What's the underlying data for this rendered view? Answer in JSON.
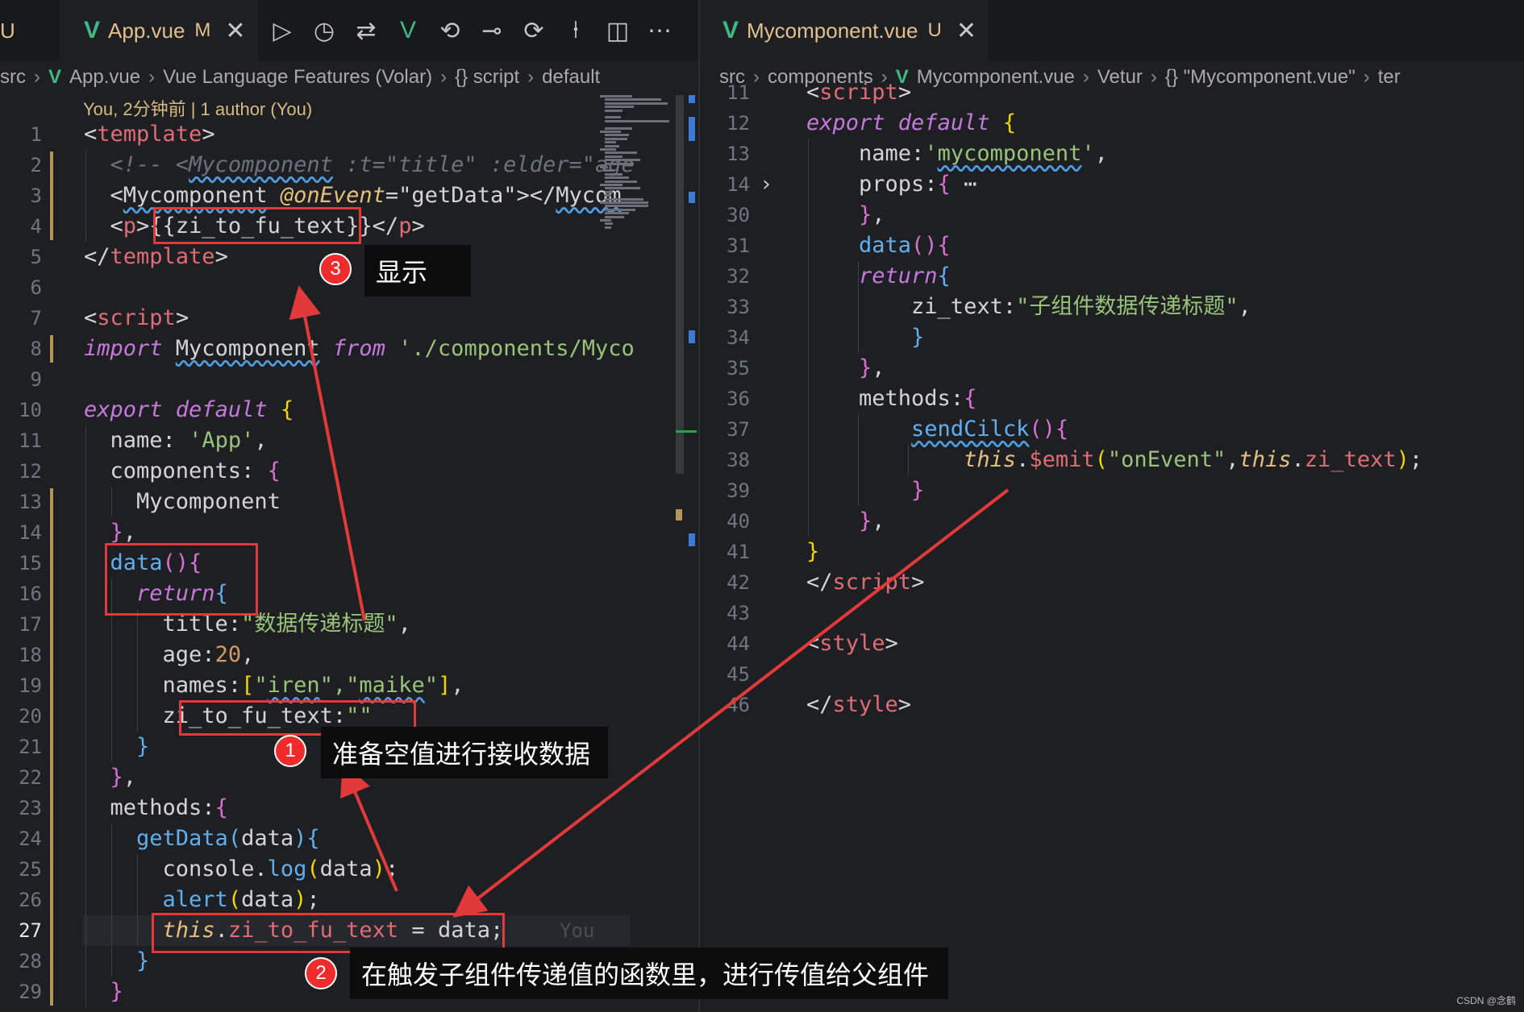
{
  "left": {
    "tab_edge_label": "U",
    "tab": {
      "icon": "vue-icon",
      "label": "App.vue",
      "flag": "M",
      "close": "✕"
    },
    "toolbar": [
      {
        "name": "run-icon",
        "glyph": "▷"
      },
      {
        "name": "timeline-icon",
        "glyph": "◷"
      },
      {
        "name": "compare-changes-icon",
        "glyph": "⇄"
      },
      {
        "name": "vue-devtools-icon",
        "glyph": "V"
      },
      {
        "name": "go-back-icon",
        "glyph": "⟲"
      },
      {
        "name": "commit-icon",
        "glyph": "⊸"
      },
      {
        "name": "go-forward-icon",
        "glyph": "⟳"
      },
      {
        "name": "git-graph-icon",
        "glyph": "⍿"
      },
      {
        "name": "split-editor-icon",
        "glyph": "◫"
      },
      {
        "name": "more-actions-icon",
        "glyph": "⋯"
      }
    ],
    "breadcrumbs": [
      "src",
      "App.vue",
      "Vue Language Features (Volar)",
      "{} script",
      "default"
    ],
    "blame": "You, 2分钟前 | 1 author (You)",
    "ghost_blame": "You",
    "lines": [
      {
        "n": "1",
        "tokens": [
          [
            "<",
            "p"
          ],
          [
            "template",
            "t"
          ],
          [
            ">",
            "p"
          ]
        ]
      },
      {
        "n": "2",
        "tokens": [
          [
            "  <!-- <",
            "c"
          ],
          [
            "Mycomponent",
            "c u"
          ],
          [
            " :t=\"title\" :elder=\"age",
            "c"
          ]
        ]
      },
      {
        "n": "3",
        "tokens": [
          [
            "  <",
            "p"
          ],
          [
            "Mycomponent",
            "p u"
          ],
          [
            " ",
            "p"
          ],
          [
            "@onEvent",
            "v"
          ],
          [
            "=",
            "p"
          ],
          [
            "\"getData\"",
            "p"
          ],
          [
            "></",
            "p"
          ],
          [
            "Mycom",
            "p u"
          ]
        ]
      },
      {
        "n": "4",
        "tokens": [
          [
            "  <",
            "p"
          ],
          [
            "p",
            "t"
          ],
          [
            ">{{",
            "p"
          ],
          [
            "zi_to_fu_text",
            "p"
          ],
          [
            "}}</",
            "p"
          ],
          [
            "p",
            "t"
          ],
          [
            ">",
            "p"
          ]
        ]
      },
      {
        "n": "5",
        "tokens": [
          [
            "</",
            "p"
          ],
          [
            "template",
            "t"
          ],
          [
            ">",
            "p"
          ]
        ]
      },
      {
        "n": "6",
        "tokens": []
      },
      {
        "n": "7",
        "tokens": [
          [
            "<",
            "p"
          ],
          [
            "script",
            "t"
          ],
          [
            ">",
            "p"
          ]
        ]
      },
      {
        "n": "8",
        "tokens": [
          [
            "import ",
            "k"
          ],
          [
            "Mycomponent",
            "p u"
          ],
          [
            " ",
            "p"
          ],
          [
            "from",
            "k"
          ],
          [
            " './components/Myco",
            "s"
          ]
        ]
      },
      {
        "n": "9",
        "tokens": []
      },
      {
        "n": "10",
        "tokens": [
          [
            "export ",
            "k"
          ],
          [
            "default",
            "k"
          ],
          [
            " ",
            "p"
          ],
          [
            "{",
            "b"
          ]
        ]
      },
      {
        "n": "11",
        "tokens": [
          [
            "  name",
            "p"
          ],
          [
            ": ",
            "p"
          ],
          [
            "'App'",
            "s"
          ],
          [
            ",",
            "p"
          ]
        ]
      },
      {
        "n": "12",
        "tokens": [
          [
            "  components",
            "p"
          ],
          [
            ": ",
            "p"
          ],
          [
            "{",
            "y"
          ]
        ]
      },
      {
        "n": "13",
        "tokens": [
          [
            "    Mycomponent",
            "p"
          ]
        ]
      },
      {
        "n": "14",
        "tokens": [
          [
            "  ",
            "p"
          ],
          [
            "}",
            "y"
          ],
          [
            ",",
            "p"
          ]
        ]
      },
      {
        "n": "15",
        "tokens": [
          [
            "  data",
            "f"
          ],
          [
            "(){",
            "y"
          ]
        ]
      },
      {
        "n": "16",
        "tokens": [
          [
            "    ",
            "p"
          ],
          [
            "return",
            "k"
          ],
          [
            "{",
            "f"
          ]
        ]
      },
      {
        "n": "17",
        "tokens": [
          [
            "      title",
            "p"
          ],
          [
            ":",
            "p"
          ],
          [
            "\"数据传递标题\"",
            "s"
          ],
          [
            ",",
            "p"
          ]
        ]
      },
      {
        "n": "18",
        "tokens": [
          [
            "      age",
            "p"
          ],
          [
            ":",
            "p"
          ],
          [
            "20",
            "n"
          ],
          [
            ",",
            "p"
          ]
        ]
      },
      {
        "n": "19",
        "tokens": [
          [
            "      names",
            "p"
          ],
          [
            ":",
            "p"
          ],
          [
            "[",
            "b"
          ],
          [
            "\"",
            "s"
          ],
          [
            "iren",
            "s u"
          ],
          [
            "\",\"",
            "s"
          ],
          [
            "maike",
            "s u"
          ],
          [
            "\"",
            "s"
          ],
          [
            "]",
            "b"
          ],
          [
            ",",
            "p"
          ]
        ]
      },
      {
        "n": "20",
        "tokens": [
          [
            "      zi_to_fu_text",
            "p"
          ],
          [
            ":",
            "p"
          ],
          [
            "\"\"",
            "s"
          ]
        ]
      },
      {
        "n": "21",
        "tokens": [
          [
            "    ",
            "p"
          ],
          [
            "}",
            "f"
          ]
        ]
      },
      {
        "n": "22",
        "tokens": [
          [
            "  ",
            "p"
          ],
          [
            "}",
            "y"
          ],
          [
            ",",
            "p"
          ]
        ]
      },
      {
        "n": "23",
        "tokens": [
          [
            "  methods",
            "p"
          ],
          [
            ":",
            "p"
          ],
          [
            "{",
            "y"
          ]
        ]
      },
      {
        "n": "24",
        "tokens": [
          [
            "    getData",
            "f"
          ],
          [
            "(",
            "f"
          ],
          [
            "data",
            "p"
          ],
          [
            ")",
            "f"
          ],
          [
            "{",
            "f"
          ]
        ]
      },
      {
        "n": "25",
        "tokens": [
          [
            "      console",
            "p"
          ],
          [
            ".",
            "p"
          ],
          [
            "log",
            "f"
          ],
          [
            "(",
            "b"
          ],
          [
            "data",
            "p"
          ],
          [
            ")",
            "b"
          ],
          [
            ";",
            "p"
          ]
        ]
      },
      {
        "n": "26",
        "tokens": [
          [
            "      alert",
            "f"
          ],
          [
            "(",
            "b"
          ],
          [
            "data",
            "p"
          ],
          [
            ")",
            "b"
          ],
          [
            ";",
            "p"
          ]
        ]
      },
      {
        "n": "27",
        "tokens": [
          [
            "      ",
            "p"
          ],
          [
            "this",
            "v"
          ],
          [
            ".",
            "p"
          ],
          [
            "zi_to_fu_text",
            "t"
          ],
          [
            " = ",
            "p"
          ],
          [
            "data",
            "p"
          ],
          [
            ";",
            "p"
          ]
        ]
      },
      {
        "n": "28",
        "tokens": [
          [
            "    ",
            "p"
          ],
          [
            "}",
            "f"
          ]
        ]
      },
      {
        "n": "29",
        "tokens": [
          [
            "  ",
            "p"
          ],
          [
            "}",
            "y"
          ]
        ]
      }
    ]
  },
  "right": {
    "tab": {
      "icon": "vue-icon",
      "label": "Mycomponent.vue",
      "flag": "U",
      "close": "✕"
    },
    "breadcrumbs": [
      "src",
      "components",
      "Mycomponent.vue",
      "Vetur",
      "{} \"Mycomponent.vue\"",
      "ter"
    ],
    "lines": [
      {
        "n": "11",
        "tokens": [
          [
            "<",
            "p"
          ],
          [
            "script",
            "t"
          ],
          [
            ">",
            "p"
          ]
        ]
      },
      {
        "n": "12",
        "tokens": [
          [
            "export ",
            "k"
          ],
          [
            "default",
            "k"
          ],
          [
            " ",
            "p"
          ],
          [
            "{",
            "b"
          ]
        ]
      },
      {
        "n": "13",
        "tokens": [
          [
            "    name",
            "p"
          ],
          [
            ":",
            "p"
          ],
          [
            "'",
            "s"
          ],
          [
            "mycomponent",
            "s u"
          ],
          [
            "'",
            "s"
          ],
          [
            ",",
            "p"
          ]
        ]
      },
      {
        "n": "14",
        "fold": "›",
        "tokens": [
          [
            "    props",
            "p"
          ],
          [
            ":",
            "p"
          ],
          [
            "{",
            "y"
          ],
          [
            " ⋯",
            "p"
          ]
        ]
      },
      {
        "n": "30",
        "tokens": [
          [
            "    ",
            "p"
          ],
          [
            "}",
            "y"
          ],
          [
            ",",
            "p"
          ]
        ]
      },
      {
        "n": "31",
        "tokens": [
          [
            "    data",
            "f"
          ],
          [
            "(){",
            "y"
          ]
        ]
      },
      {
        "n": "32",
        "tokens": [
          [
            "    ",
            "p"
          ],
          [
            "return",
            "k"
          ],
          [
            "{",
            "f"
          ]
        ]
      },
      {
        "n": "33",
        "tokens": [
          [
            "        zi_text",
            "p"
          ],
          [
            ":",
            "p"
          ],
          [
            "\"子组件数据传递标题\"",
            "s"
          ],
          [
            ",",
            "p"
          ]
        ]
      },
      {
        "n": "34",
        "tokens": [
          [
            "        ",
            "p"
          ],
          [
            "}",
            "f"
          ]
        ]
      },
      {
        "n": "35",
        "tokens": [
          [
            "    ",
            "p"
          ],
          [
            "}",
            "y"
          ],
          [
            ",",
            "p"
          ]
        ]
      },
      {
        "n": "36",
        "tokens": [
          [
            "    methods",
            "p"
          ],
          [
            ":",
            "p"
          ],
          [
            "{",
            "y"
          ]
        ]
      },
      {
        "n": "37",
        "tokens": [
          [
            "        ",
            "p"
          ],
          [
            "sendCilck",
            "f u"
          ],
          [
            "(){",
            "y"
          ]
        ]
      },
      {
        "n": "38",
        "tokens": [
          [
            "            ",
            "p"
          ],
          [
            "this",
            "v"
          ],
          [
            ".",
            "p"
          ],
          [
            "$emit",
            "t"
          ],
          [
            "(",
            "b"
          ],
          [
            "\"onEvent\"",
            "s"
          ],
          [
            ",",
            "p"
          ],
          [
            "this",
            "v"
          ],
          [
            ".",
            "p"
          ],
          [
            "zi_text",
            "t"
          ],
          [
            ")",
            "b"
          ],
          [
            ";",
            "p"
          ]
        ]
      },
      {
        "n": "39",
        "tokens": [
          [
            "        ",
            "p"
          ],
          [
            "}",
            "y"
          ]
        ]
      },
      {
        "n": "40",
        "tokens": [
          [
            "    ",
            "p"
          ],
          [
            "}",
            "y"
          ],
          [
            ",",
            "p"
          ]
        ]
      },
      {
        "n": "41",
        "tokens": [
          [
            "}",
            "b"
          ]
        ]
      },
      {
        "n": "42",
        "tokens": [
          [
            "</",
            "p"
          ],
          [
            "script",
            "t"
          ],
          [
            ">",
            "p"
          ]
        ]
      },
      {
        "n": "43",
        "tokens": []
      },
      {
        "n": "44",
        "tokens": [
          [
            "<",
            "p"
          ],
          [
            "style",
            "t"
          ],
          [
            ">",
            "p"
          ]
        ]
      },
      {
        "n": "45",
        "tokens": []
      },
      {
        "n": "46",
        "tokens": [
          [
            "</",
            "p"
          ],
          [
            "style",
            "t"
          ],
          [
            ">",
            "p"
          ]
        ]
      }
    ]
  },
  "annotations": [
    {
      "num": "1",
      "text": "准备空值进行接收数据"
    },
    {
      "num": "2",
      "text": "在触发子组件传递值的函数里，进行传值给父组件"
    },
    {
      "num": "3",
      "text": "显示"
    }
  ],
  "watermark": "CSDN @念鹤",
  "colors": {
    "annotation": "#e23a3a",
    "vue": "#41b883"
  }
}
